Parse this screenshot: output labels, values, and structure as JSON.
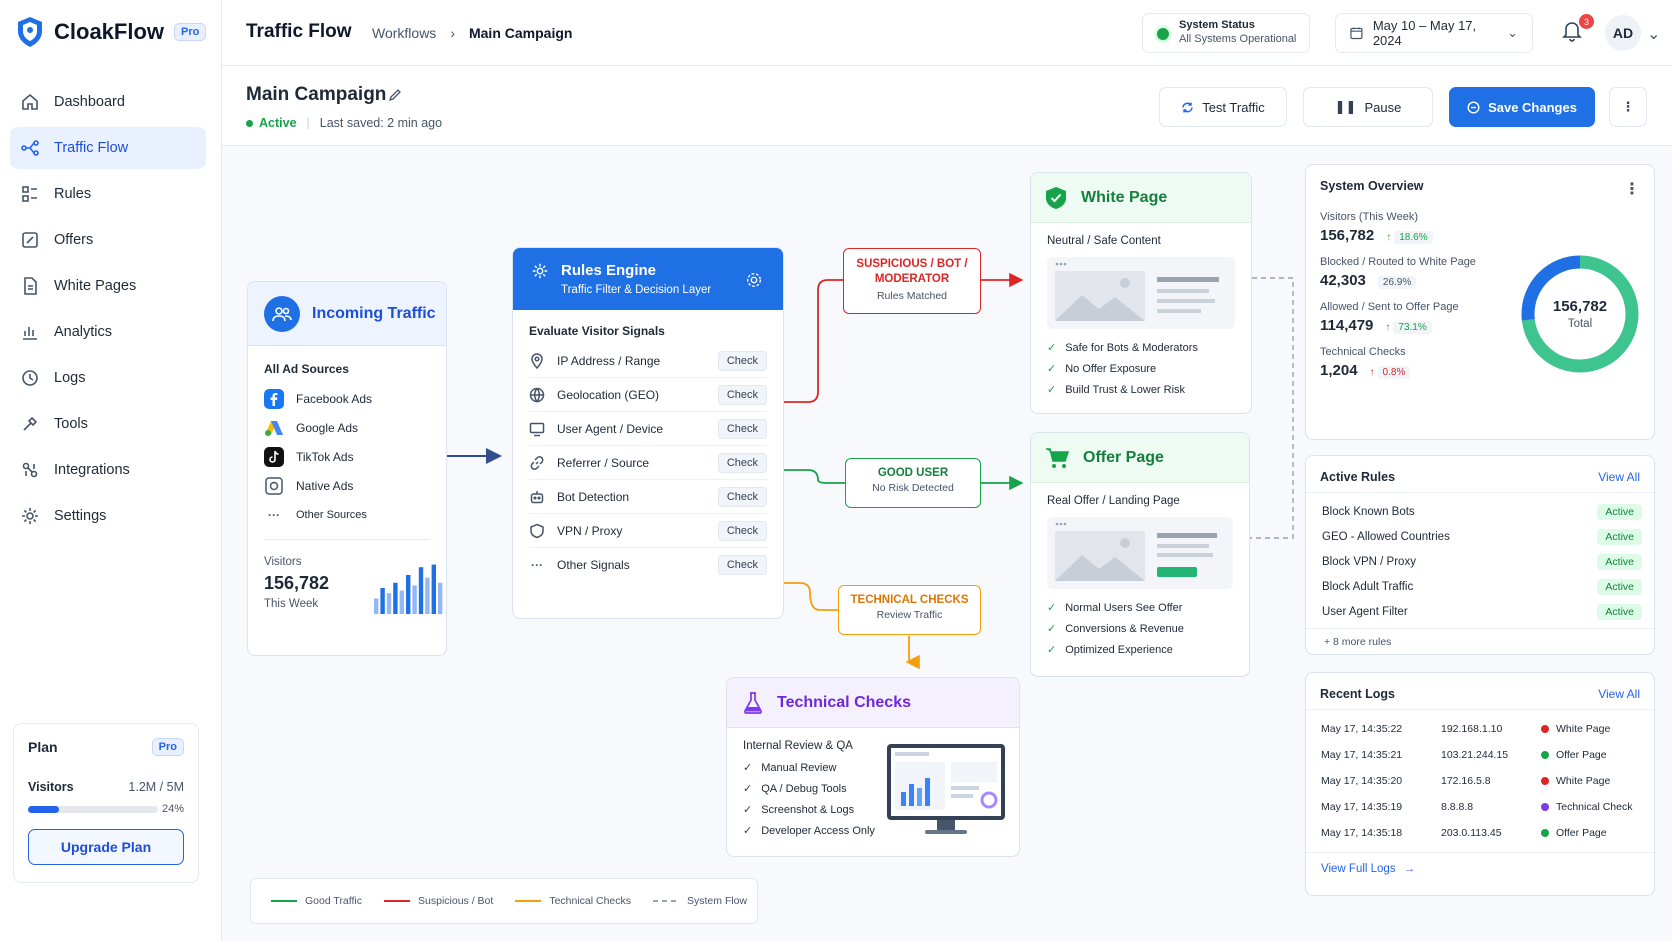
{
  "app": {
    "name": "CloakFlow",
    "plan_badge": "Pro"
  },
  "sidebar": {
    "items": [
      {
        "label": "Dashboard",
        "icon": "home-icon"
      },
      {
        "label": "Traffic Flow",
        "icon": "flow-icon"
      },
      {
        "label": "Rules",
        "icon": "rules-icon"
      },
      {
        "label": "Offers",
        "icon": "offers-icon"
      },
      {
        "label": "White Pages",
        "icon": "page-icon"
      },
      {
        "label": "Analytics",
        "icon": "analytics-icon"
      },
      {
        "label": "Logs",
        "icon": "logs-icon"
      },
      {
        "label": "Tools",
        "icon": "tools-icon"
      },
      {
        "label": "Integrations",
        "icon": "integrations-icon"
      },
      {
        "label": "Settings",
        "icon": "gear-icon"
      }
    ],
    "plan": {
      "title": "Plan",
      "badge": "Pro",
      "visitors_label": "Visitors",
      "visitors_value": "1.2M / 5M",
      "percent_label": "24%",
      "percent": 0.24,
      "upgrade": "Upgrade Plan"
    }
  },
  "header": {
    "title": "Traffic Flow",
    "breadcrumb": [
      "Workflows",
      "Main Campaign"
    ],
    "status_title": "System Status",
    "status_text": "All Systems Operational",
    "date_range": "May 10 – May 17, 2024",
    "notifications": "3",
    "avatar": "AD"
  },
  "campaign": {
    "name": "Main Campaign",
    "status": "Active",
    "last_saved": "Last saved: 2 min ago",
    "btn_test": "Test Traffic",
    "btn_pause": "Pause",
    "btn_save": "Save Changes"
  },
  "incoming": {
    "title": "Incoming Traffic",
    "sources_title": "All Ad Sources",
    "sources": [
      "Facebook Ads",
      "Google Ads",
      "TikTok Ads",
      "Native Ads",
      "Other Sources"
    ],
    "visitors_label": "Visitors",
    "visitors_value": "156,782",
    "visitors_period": "This Week",
    "bars": [
      0.3,
      0.5,
      0.4,
      0.6,
      0.45,
      0.75,
      0.55,
      0.9,
      0.7,
      0.95,
      0.6
    ]
  },
  "rules_engine": {
    "title": "Rules Engine",
    "subtitle": "Traffic Filter & Decision Layer",
    "section": "Evaluate Visitor Signals",
    "check_label": "Check",
    "signals": [
      "IP Address / Range",
      "Geolocation (GEO)",
      "User Agent / Device",
      "Referrer / Source",
      "Bot Detection",
      "VPN / Proxy",
      "Other Signals"
    ]
  },
  "labels": {
    "suspicious_title": "SUSPICIOUS / BOT / MODERATOR",
    "suspicious_sub": "Rules Matched",
    "good_title": "GOOD USER",
    "good_sub": "No Risk Detected",
    "tech_title": "TECHNICAL CHECKS",
    "tech_sub": "Review Traffic"
  },
  "white_page": {
    "title": "White Page",
    "subtitle": "Neutral / Safe Content",
    "points": [
      "Safe for Bots & Moderators",
      "No Offer Exposure",
      "Build Trust & Lower Risk"
    ]
  },
  "offer_page": {
    "title": "Offer Page",
    "subtitle": "Real Offer / Landing Page",
    "points": [
      "Normal Users See Offer",
      "Conversions & Revenue",
      "Optimized Experience"
    ]
  },
  "tech_checks": {
    "title": "Technical Checks",
    "subtitle": "Internal Review & QA",
    "points": [
      "Manual Review",
      "QA / Debug Tools",
      "Screenshot & Logs",
      "Developer Access Only"
    ]
  },
  "legend": [
    "Good Traffic",
    "Suspicious / Bot",
    "Technical Checks",
    "System Flow"
  ],
  "colors": {
    "good": "#16a34a",
    "suspicious": "#dc2626",
    "technical": "#f59e0b",
    "system": "#94a3b8",
    "accent": "#1f6fe5"
  },
  "overview": {
    "title": "System Overview",
    "stats": [
      {
        "label": "Visitors (This Week)",
        "value": "156,782",
        "change": "18.6%",
        "dir": "up",
        "color": "#16a34a"
      },
      {
        "label": "Blocked / Routed to White Page",
        "value": "42,303",
        "change": "26.9%",
        "dir": "",
        "color": "#475569"
      },
      {
        "label": "Allowed / Sent to Offer Page",
        "value": "114,479",
        "change": "73.1%",
        "dir": "up",
        "color": "#16a34a"
      },
      {
        "label": "Technical Checks",
        "value": "1,204",
        "change": "0.8%",
        "dir": "up",
        "color": "#dc2626"
      }
    ],
    "donut_value": "156,782",
    "donut_label": "Total",
    "donut_split": [
      0.731,
      0.269
    ]
  },
  "active_rules": {
    "title": "Active Rules",
    "view_all": "View All",
    "rules": [
      "Block Known Bots",
      "GEO - Allowed Countries",
      "Block VPN / Proxy",
      "Block Adult Traffic",
      "User Agent Filter"
    ],
    "status": "Active",
    "more": "+ 8 more rules"
  },
  "recent_logs": {
    "title": "Recent Logs",
    "view_all": "View All",
    "rows": [
      {
        "time": "May 17, 14:35:22",
        "ip": "192.168.1.10",
        "dest": "White Page",
        "color": "#dc2626"
      },
      {
        "time": "May 17, 14:35:21",
        "ip": "103.21.244.15",
        "dest": "Offer Page",
        "color": "#16a34a"
      },
      {
        "time": "May 17, 14:35:20",
        "ip": "172.16.5.8",
        "dest": "White Page",
        "color": "#dc2626"
      },
      {
        "time": "May 17, 14:35:19",
        "ip": "8.8.8.8",
        "dest": "Technical Check",
        "color": "#7c3aed"
      },
      {
        "time": "May 17, 14:35:18",
        "ip": "203.0.113.45",
        "dest": "Offer Page",
        "color": "#16a34a"
      }
    ],
    "full": "View Full Logs"
  }
}
